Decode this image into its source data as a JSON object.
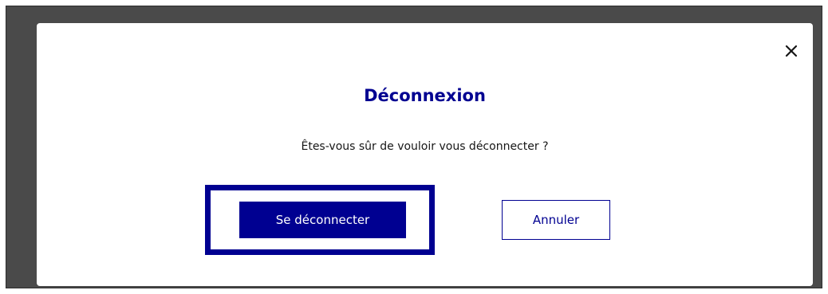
{
  "dialog": {
    "title": "Déconnexion",
    "message": "Êtes-vous sûr de vouloir vous déconnecter ?",
    "close_icon": "close-icon",
    "primary_button_label": "Se déconnecter",
    "secondary_button_label": "Annuler"
  },
  "colors": {
    "brand_blue": "#000091",
    "backdrop": "#4a4a4a",
    "text": "#161616"
  }
}
